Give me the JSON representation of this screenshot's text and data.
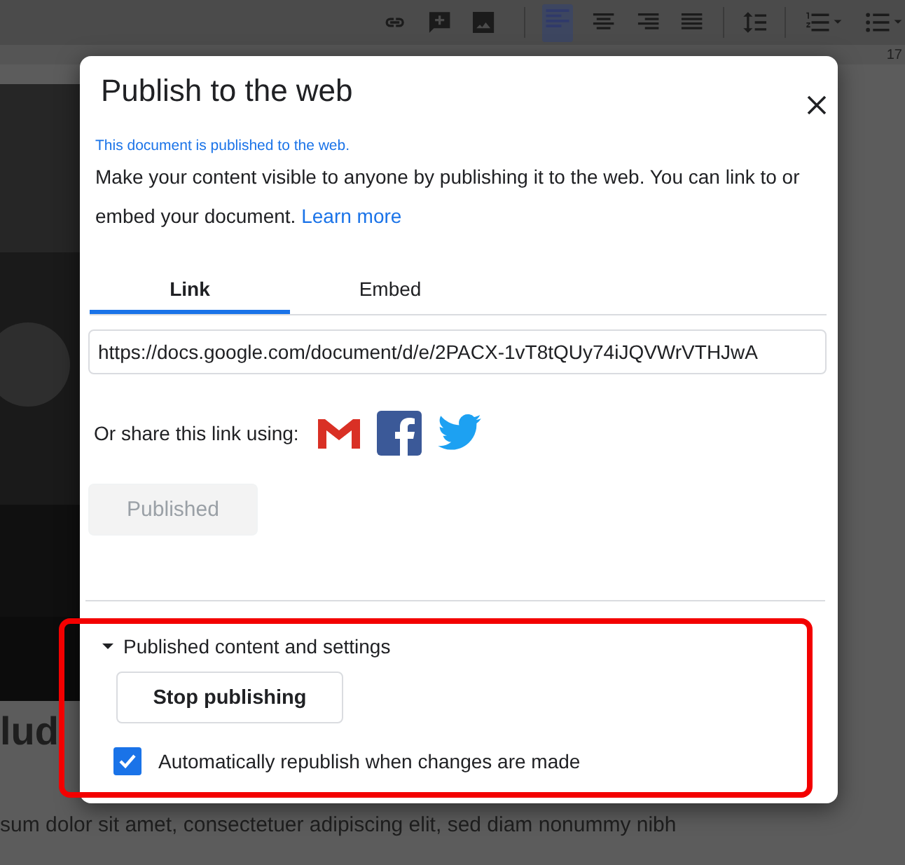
{
  "editor": {
    "ruler_number": "17",
    "heading_fragment": "lud",
    "body_fragment": "sum dolor sit amet, consectetuer adipiscing elit, sed diam nonummy nibh"
  },
  "dialog": {
    "title": "Publish to the web",
    "status": "This document is published to the web.",
    "description": "Make your content visible to anyone by publishing it to the web. You can link to or embed your document.",
    "learn_more": "Learn more",
    "tabs": [
      {
        "label": "Link",
        "selected": true
      },
      {
        "label": "Embed",
        "selected": false
      }
    ],
    "link_field": {
      "value": "https://docs.google.com/document/d/e/2PACX-1vT8tQUy74iJQVWrVTHJwA"
    },
    "share_label": "Or share this link using:",
    "share_targets": [
      {
        "kind": "gmail"
      },
      {
        "kind": "facebook"
      },
      {
        "kind": "twitter"
      }
    ],
    "publish_button": {
      "label": "Published",
      "disabled": true
    },
    "settings": {
      "label": "Published content and settings",
      "expanded": true,
      "highlighted": true,
      "stop_button": "Stop publishing",
      "auto_republish": {
        "label": "Automatically republish when changes are made",
        "checked": true
      }
    }
  }
}
